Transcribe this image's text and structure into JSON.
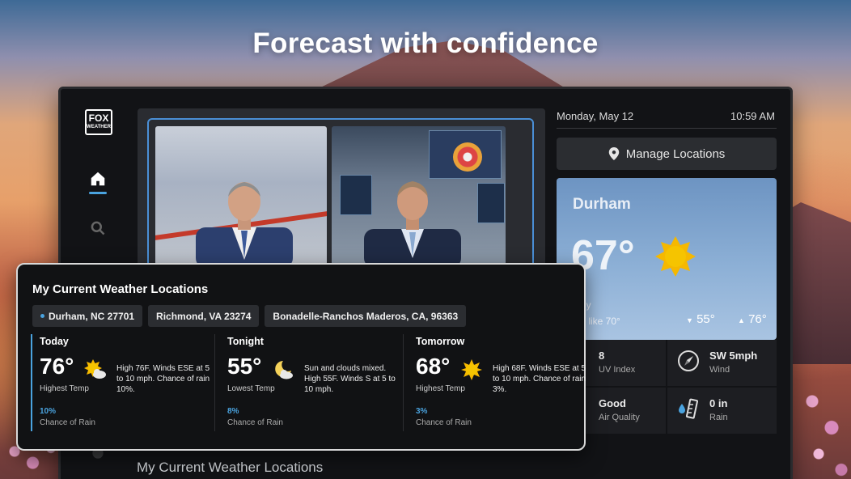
{
  "headline": "Forecast with confidence",
  "app": {
    "logo_line1": "FOX",
    "logo_line2": "WEATHER",
    "date": "Monday, May 12",
    "time": "10:59 AM",
    "manage_label": "Manage Locations",
    "bottom_title": "My Current Weather Locations"
  },
  "weather_card": {
    "city": "Durham",
    "temp": "67°",
    "sky_fragment": "ny",
    "feels_like_fragment": "s like 70°",
    "low": "55°",
    "high": "76°",
    "icon": "sun-icon"
  },
  "stats": [
    {
      "value": "8",
      "label": "UV Index",
      "icon": "uv-icon"
    },
    {
      "value": "SW 5mph",
      "label": "Wind",
      "icon": "compass-icon"
    },
    {
      "value": "Good",
      "label": "Air Quality",
      "icon": "air-icon"
    },
    {
      "value": "0 in",
      "label": "Rain",
      "icon": "rain-gauge-icon"
    }
  ],
  "panel": {
    "title": "My Current Weather Locations",
    "locations": [
      "Durham, NC 27701",
      "Richmond, VA 23274",
      "Bonadelle-Ranchos Maderos, CA, 96363"
    ],
    "forecasts": [
      {
        "label": "Today",
        "temp": "76°",
        "sub": "Highest Temp",
        "desc": "High 76F. Winds ESE at 5 to 10 mph. Chance of rain 10%.",
        "pct": "10%",
        "rain": "Chance of Rain",
        "icon": "partly-sunny-icon"
      },
      {
        "label": "Tonight",
        "temp": "55°",
        "sub": "Lowest Temp",
        "desc": "Sun and clouds mixed. High 55F. Winds S at 5 to 10 mph.",
        "pct": "8%",
        "rain": "Chance of Rain",
        "icon": "moon-cloud-icon"
      },
      {
        "label": "Tomorrow",
        "temp": "68°",
        "sub": "Highest Temp",
        "desc": "High 68F. Winds ESE at 5 to 10 mph. Chance of rain 3%.",
        "pct": "3%",
        "rain": "Chance of Rain",
        "icon": "sun-icon"
      }
    ]
  },
  "colors": {
    "accent": "#4aa3df",
    "sun": "#f5b800"
  }
}
